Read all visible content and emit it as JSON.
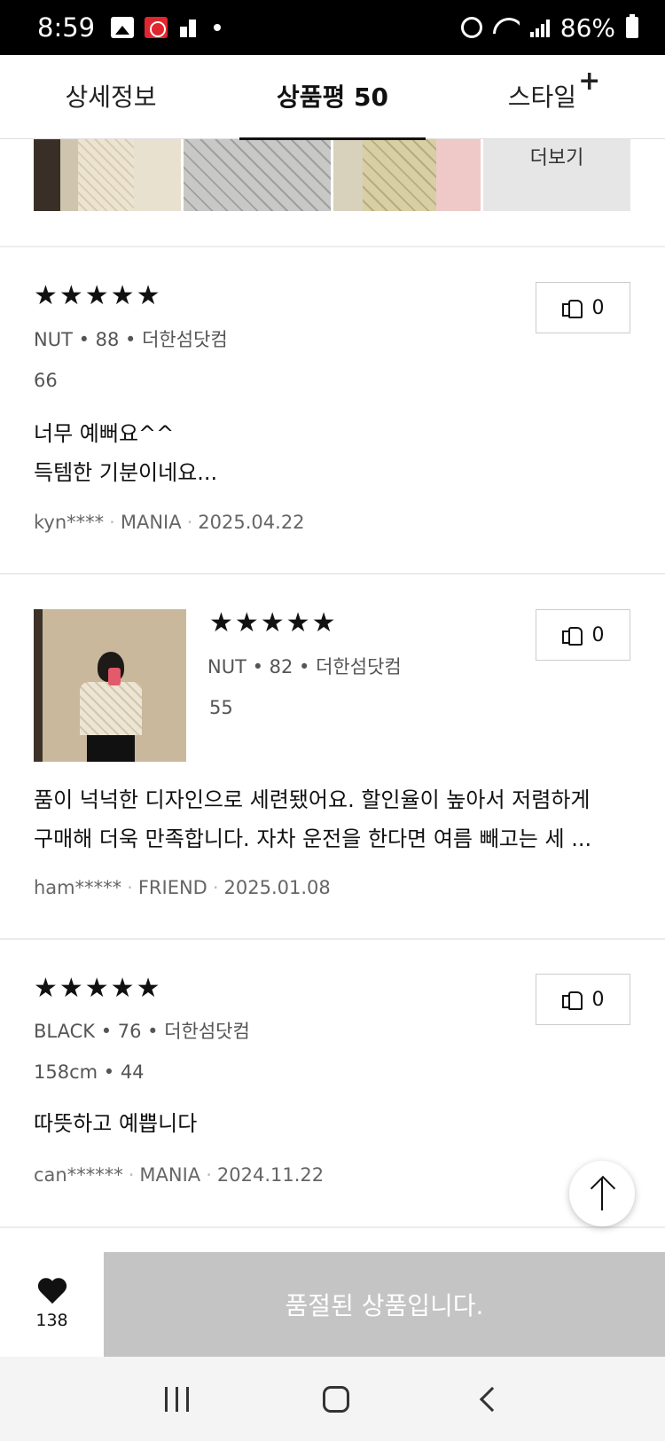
{
  "status_bar": {
    "time": "8:59",
    "battery": "86%"
  },
  "tabs": [
    {
      "label": "상세정보"
    },
    {
      "label": "상품평 50"
    },
    {
      "label": "스타일",
      "badge": "+"
    }
  ],
  "photo_strip": {
    "more_label": "더보기"
  },
  "reviews": [
    {
      "stars": "★★★★★",
      "meta": "NUT • 88 • 더한섬닷컴",
      "sub": "66",
      "text_lines": [
        "너무 예뻐요^^",
        "득템한 기분이네요..."
      ],
      "user": "kyn****",
      "grade": "MANIA",
      "date": "2025.04.22",
      "likes": "0"
    },
    {
      "stars": "★★★★★",
      "meta": "NUT • 82 • 더한섬닷컴",
      "sub": "55",
      "text_lines": [
        "품이 넉넉한 디자인으로 세련됐어요. 할인율이 높아서 저렴하게",
        "구매해 더욱 만족합니다. 자차 운전을 한다면 여름 빼고는 세 ..."
      ],
      "user": "ham*****",
      "grade": "FRIEND",
      "date": "2025.01.08",
      "likes": "0"
    },
    {
      "stars": "★★★★★",
      "meta": "BLACK • 76 • 더한섬닷컴",
      "sub": "158cm • 44",
      "text_lines": [
        "따뜻하고 예쁩니다"
      ],
      "user": "can******",
      "grade": "MANIA",
      "date": "2024.11.22",
      "likes": "0"
    }
  ],
  "action_bar": {
    "wish_count": "138",
    "soldout_label": "품절된 상품입니다."
  },
  "icons": {
    "like": "thumbs-up-icon",
    "wish": "heart-icon",
    "top": "arrow-up-icon"
  }
}
